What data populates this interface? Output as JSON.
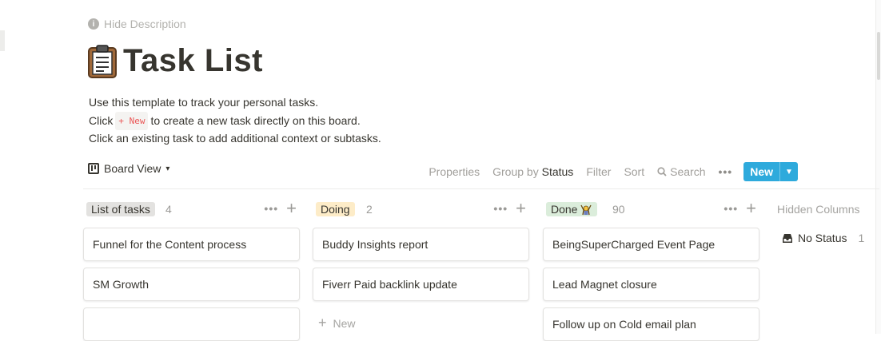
{
  "header": {
    "hide_description": "Hide Description",
    "page_title": "Task List"
  },
  "description": {
    "line1": "Use this template to track your personal tasks.",
    "line2_before": "Click",
    "inline_code": "+ New",
    "line2_after": "to create a new task directly on this board.",
    "line3": "Click an existing task to add additional context or subtasks."
  },
  "toolbar": {
    "view_label": "Board View",
    "properties": "Properties",
    "group_by": "Group by",
    "group_by_value": "Status",
    "filter": "Filter",
    "sort": "Sort",
    "search": "Search",
    "more": "•••",
    "new_label": "New",
    "accent_color": "#2eaadc"
  },
  "columns": [
    {
      "name": "List of tasks",
      "count": "4",
      "tag_color": "#e3e2e0",
      "cards": [
        "Funnel for the Content process",
        "SM Growth",
        ""
      ]
    },
    {
      "name": "Doing",
      "count": "2",
      "tag_color": "#fdecc8",
      "cards": [
        "Buddy Insights report",
        "Fiverr Paid backlink update"
      ],
      "new_label": "New"
    },
    {
      "name": "Done",
      "count": "90",
      "tag_color": "#dbeddb",
      "tag_emoji": "cheering-person-icon",
      "cards": [
        "BeingSuperCharged Event Page",
        "Lead Magnet closure",
        "Follow up on Cold email plan"
      ]
    }
  ],
  "hidden_columns": {
    "label": "Hidden Columns",
    "items": [
      {
        "name": "No Status",
        "count": "1",
        "icon": "inbox-icon"
      }
    ]
  }
}
